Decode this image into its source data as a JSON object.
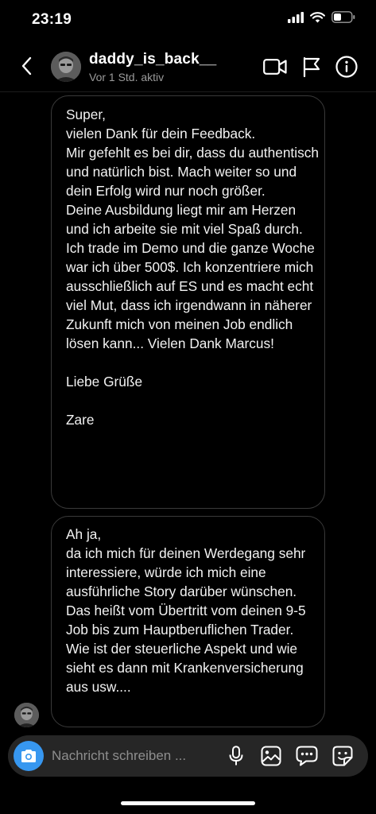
{
  "status_bar": {
    "time": "23:19"
  },
  "header": {
    "username": "daddy_is_back__",
    "activity": "Vor 1 Std. aktiv",
    "icons": [
      "chevron-left-icon",
      "video-call-icon",
      "flag-icon",
      "info-icon"
    ]
  },
  "messages": [
    {
      "sender": "other",
      "text": "Super,\nvielen Dank für dein Feedback.\nMir gefehlt es bei dir, dass du authentisch und natürlich bist. Mach weiter so und dein Erfolg wird nur noch größer.\nDeine Ausbildung liegt mir am Herzen und ich arbeite sie mit viel Spaß durch. Ich trade im Demo und die ganze Woche war ich über 500$. Ich konzentriere mich ausschließlich auf ES und es macht echt viel Mut, dass ich irgendwann in näherer Zukunft mich von meinen Job endlich lösen kann... Vielen Dank Marcus!\n\nLiebe Grüße\n\nZare"
    },
    {
      "sender": "other",
      "text": "Ah ja,\nda ich mich für deinen Werdegang sehr interessiere, würde ich mich eine ausführliche Story darüber wünschen. Das heißt vom Übertritt vom deinen 9-5 Job bis zum Hauptberuflichen  Trader. Wie ist der steuerliche Aspekt und wie sieht es dann mit Krankenversicherung aus usw...."
    }
  ],
  "composer": {
    "placeholder": "Nachricht schreiben ...",
    "value": "",
    "icons": [
      "camera-icon",
      "microphone-icon",
      "gallery-icon",
      "chat-bubble-icon",
      "sticker-icon"
    ]
  },
  "colors": {
    "background": "#000000",
    "bubble_border": "#3a3a3a",
    "composer_bg": "#262626",
    "camera_accent": "#3797f0",
    "secondary_text": "#9a9a9a"
  }
}
